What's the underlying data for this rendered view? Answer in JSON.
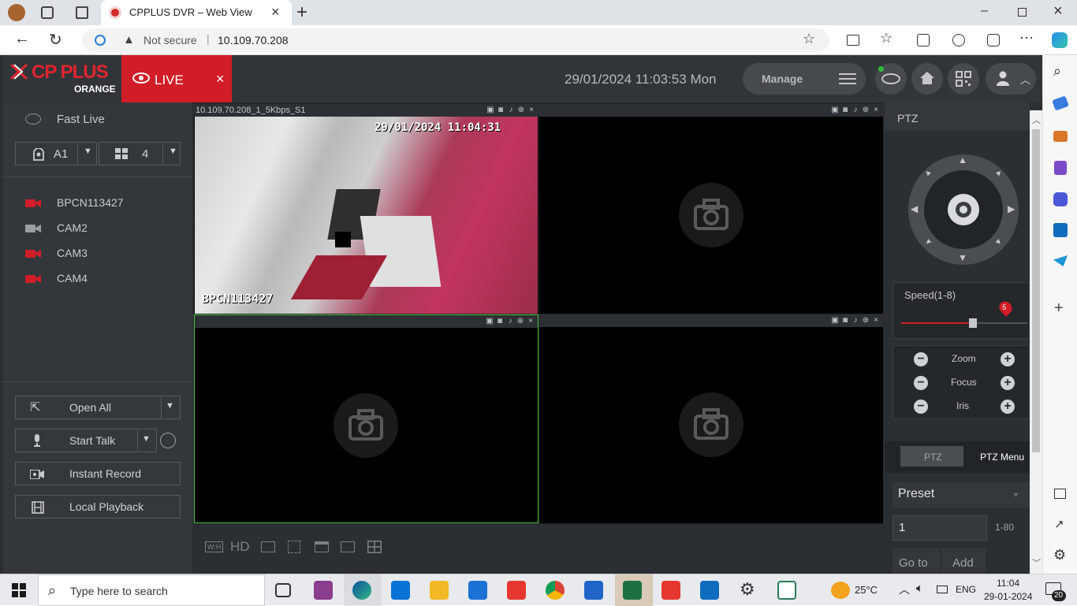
{
  "browser": {
    "tab_title": "CPPLUS DVR – Web View",
    "address_security": "Not secure",
    "address_url": "10.109.70.208"
  },
  "header": {
    "logo_text": "CP PLUS",
    "logo_sub": "ORANGE",
    "live_tab_label": "LIVE",
    "datetime": "29/01/2024 11:03:53 Mon",
    "manage_label": "Manage"
  },
  "left": {
    "fast_live": "Fast Live",
    "group_value": "A1",
    "split_value": "4",
    "cameras": [
      {
        "label": "BPCN113427",
        "status": "offline-red"
      },
      {
        "label": "CAM2",
        "status": "gray"
      },
      {
        "label": "CAM3",
        "status": "offline-red"
      },
      {
        "label": "CAM4",
        "status": "offline-red"
      }
    ],
    "open_all": "Open All",
    "start_talk": "Start Talk",
    "instant_record": "Instant Record",
    "local_playback": "Local Playback"
  },
  "video": {
    "tile1_title": "10.109.70.208_1_5Kbps_S1",
    "tile1_osd_time": "29/01/2024 11:04:31",
    "tile1_osd_name": "BPCN113427",
    "toolbar_hd": "HD",
    "toolbar_wh": "W:H"
  },
  "ptz": {
    "title": "PTZ",
    "speed_label": "Speed(1-8)",
    "speed_value": "5",
    "speed_fraction": 0.57,
    "zoom": "Zoom",
    "focus": "Focus",
    "iris": "Iris",
    "tab_ptz": "PTZ",
    "tab_ptz_menu": "PTZ Menu",
    "preset_select": "Preset",
    "preset_value": "1",
    "preset_range": "1-80",
    "goto_label": "Go to",
    "add_label": "Add"
  },
  "taskbar": {
    "search_placeholder": "Type here to search",
    "weather": "25°C",
    "lang": "ENG",
    "time": "11:04",
    "date": "29-01-2024",
    "notif_count": "20"
  },
  "colors": {
    "brand_red": "#e0252f",
    "live_red": "#d11d27",
    "active_tile_border": "#4bbf3a"
  }
}
